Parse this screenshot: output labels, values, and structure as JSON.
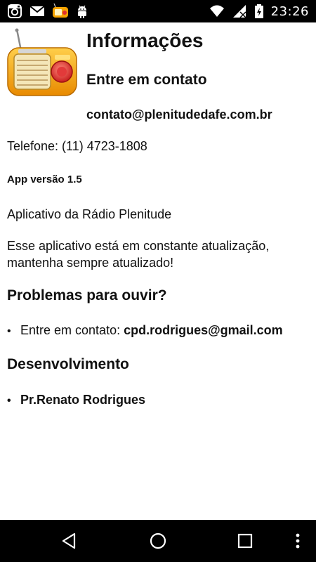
{
  "status_bar": {
    "time": "23:26",
    "left_icons": [
      "instagram-icon",
      "mail-icon",
      "radio-app-icon",
      "android-icon"
    ],
    "right_icons": [
      "wifi-icon",
      "signal-icon",
      "battery-charging-icon"
    ]
  },
  "page": {
    "title": "Informações",
    "contact_heading": "Entre em contato",
    "contact_email": "contato@plenitudedafe.com.br",
    "phone": "Telefone: (11) 4723-1808",
    "version": "App versão 1.5",
    "about": "Aplicativo da Rádio Plenitude",
    "notice": "Esse aplicativo está em constante atualização, mantenha sempre atualizado!",
    "problems_heading": "Problemas para ouvir?",
    "problems_item_prefix": "Entre em contato: ",
    "problems_item_email": "cpd.rodrigues@gmail.com",
    "dev_heading": "Desenvolvimento",
    "dev_item": "Pr.Renato Rodrigues",
    "bullet": "•"
  },
  "nav_bar": {
    "buttons": [
      "back-icon",
      "home-icon",
      "recents-icon",
      "overflow-menu-icon"
    ]
  }
}
